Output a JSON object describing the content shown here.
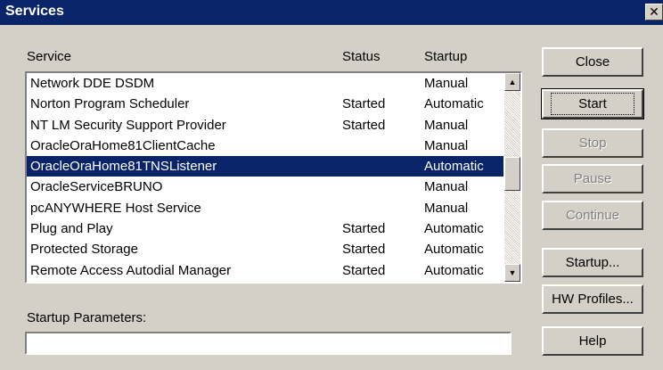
{
  "window": {
    "title": "Services",
    "close_glyph": "✕"
  },
  "headers": {
    "service": "Service",
    "status": "Status",
    "startup": "Startup"
  },
  "rows": [
    {
      "service": "Network DDE DSDM",
      "status": "",
      "startup": "Manual",
      "selected": false
    },
    {
      "service": "Norton Program Scheduler",
      "status": "Started",
      "startup": "Automatic",
      "selected": false
    },
    {
      "service": "NT LM Security Support Provider",
      "status": "Started",
      "startup": "Manual",
      "selected": false
    },
    {
      "service": "OracleOraHome81ClientCache",
      "status": "",
      "startup": "Manual",
      "selected": false
    },
    {
      "service": "OracleOraHome81TNSListener",
      "status": "",
      "startup": "Automatic",
      "selected": true
    },
    {
      "service": "OracleServiceBRUNO",
      "status": "",
      "startup": "Manual",
      "selected": false
    },
    {
      "service": "pcANYWHERE Host Service",
      "status": "",
      "startup": "Manual",
      "selected": false
    },
    {
      "service": "Plug and Play",
      "status": "Started",
      "startup": "Automatic",
      "selected": false
    },
    {
      "service": "Protected Storage",
      "status": "Started",
      "startup": "Automatic",
      "selected": false
    },
    {
      "service": "Remote Access Autodial Manager",
      "status": "Started",
      "startup": "Automatic",
      "selected": false
    }
  ],
  "buttons": {
    "close": "Close",
    "start": "Start",
    "stop": "Stop",
    "pause": "Pause",
    "continue": "Continue",
    "startup": "Startup...",
    "hw_profiles": "HW Profiles...",
    "help": "Help"
  },
  "startup_parameters": {
    "label": "Startup Parameters:",
    "value": ""
  },
  "scrollbar": {
    "up_glyph": "▲",
    "down_glyph": "▼"
  }
}
